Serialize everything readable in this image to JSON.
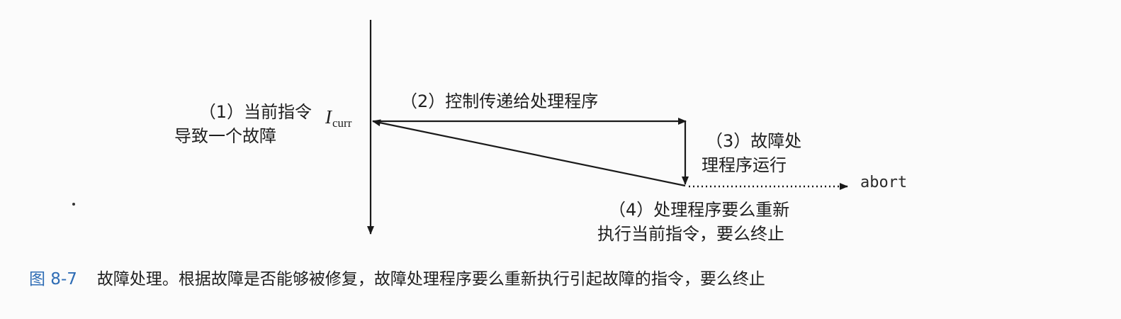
{
  "labels": {
    "step1_line1": "（1）当前指令",
    "step1_line2": "导致一个故障",
    "step2": "（2）控制传递给处理程序",
    "step3_line1": "（3）故障处",
    "step3_line2": "理程序运行",
    "step4_line1": "（4）处理程序要么重新",
    "step4_line2": "执行当前指令，要么终止"
  },
  "instruction": {
    "symbol": "I",
    "subscript": "curr"
  },
  "abort_label": "abort",
  "caption": {
    "figure_number": "图 8-7",
    "text": "故障处理。根据故障是否能够被修复，故障处理程序要么重新执行引起故障的指令，要么终止"
  },
  "colors": {
    "line": "#1a1a1a",
    "caption_number": "#2f6db5"
  }
}
